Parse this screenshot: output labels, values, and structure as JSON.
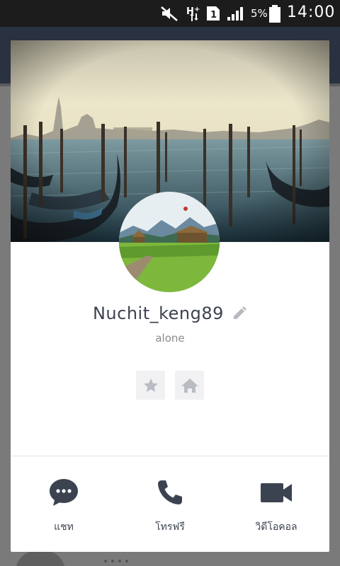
{
  "status_bar": {
    "battery_percent": "5%",
    "time": "14:00",
    "icons": [
      "mute-icon",
      "data-icon",
      "sim-icon",
      "signal-icon",
      "battery-icon"
    ]
  },
  "profile": {
    "name": "Nuchit_keng89",
    "status_message": "alone"
  },
  "actions": {
    "chat_label": "แชท",
    "call_label": "โทรฟรี",
    "video_label": "วิดีโอคอล"
  },
  "colors": {
    "accent": "#3c4350",
    "overlay_bg": "#6d6d6d",
    "card_bg": "#ffffff"
  }
}
